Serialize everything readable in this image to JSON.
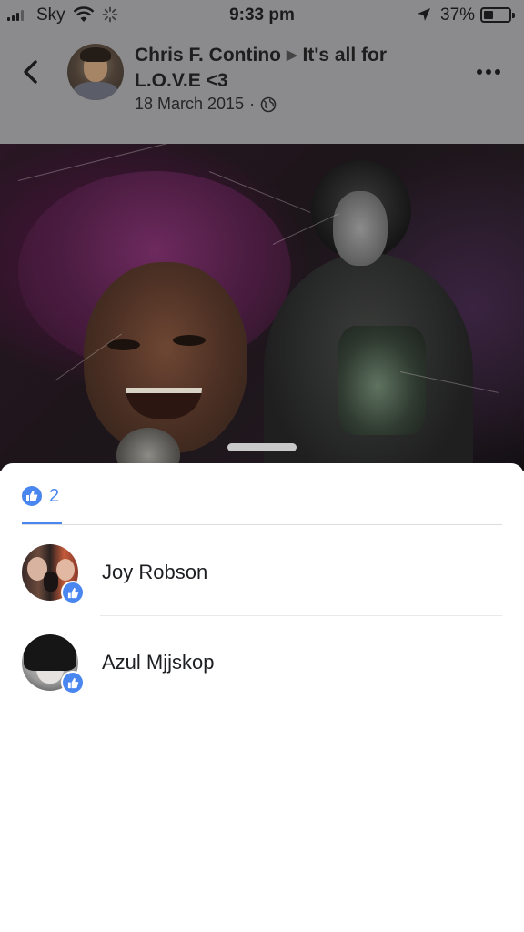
{
  "status_bar": {
    "carrier": "Sky",
    "time": "9:33 pm",
    "battery_percent": "37%",
    "battery_level": 0.37,
    "icons": [
      "signal-icon",
      "wifi-icon",
      "activity-spinner-icon",
      "location-arrow-icon",
      "battery-icon"
    ]
  },
  "post": {
    "author": "Chris F. Contino",
    "separator_icon": "triangle-right-icon",
    "target_line": "It's all for L.O.V.E <3",
    "date": "18 March 2015",
    "meta_separator": "·",
    "privacy_icon": "globe-icon"
  },
  "nav": {
    "back_icon": "chevron-left-icon",
    "more_icon": "more-horizontal-icon"
  },
  "reactions": {
    "tab_icon": "like-icon",
    "like_count": "2",
    "accent_color": "#4a86f0",
    "people": [
      {
        "name": "Joy Robson",
        "reaction_icon": "like-icon"
      },
      {
        "name": "Azul Mjjskop",
        "reaction_icon": "like-icon"
      }
    ]
  }
}
